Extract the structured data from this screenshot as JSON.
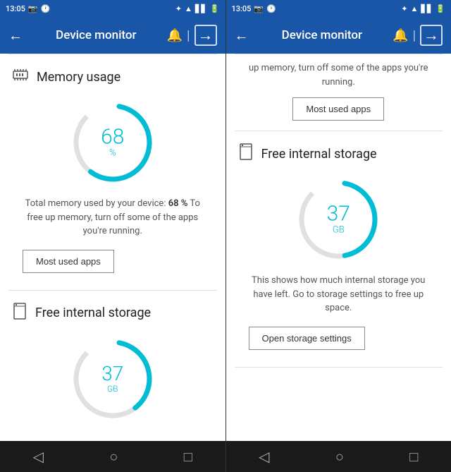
{
  "panel1": {
    "statusBar": {
      "time": "13:05",
      "icons": [
        "📷",
        "🔵"
      ]
    },
    "toolbar": {
      "title": "Device monitor",
      "backIcon": "←",
      "bellIcon": "🔔",
      "divider": "|",
      "exitIcon": "⊡"
    },
    "memorySection": {
      "icon": "⬡",
      "title": "Memory usage",
      "gaugeValue": "68",
      "gaugeUnit": "%",
      "description": "Total memory used by your device: 68 % To free up memory, turn off some of the apps you're running.",
      "buttonLabel": "Most used apps"
    },
    "storageSection": {
      "icon": "🗒",
      "title": "Free internal storage"
    },
    "bottomNav": {
      "back": "◁",
      "home": "○",
      "recent": "□"
    }
  },
  "panel2": {
    "statusBar": {
      "time": "13:05"
    },
    "toolbar": {
      "title": "Device monitor",
      "backIcon": "←",
      "bellIcon": "🔔",
      "divider": "|",
      "exitIcon": "⊡"
    },
    "scrolledText": "up memory, turn off some of the apps you're running.",
    "mostUsedAppsButton": "Most used apps",
    "storageSection": {
      "icon": "🗒",
      "title": "Free internal storage",
      "gaugeValue": "37",
      "gaugeUnit": "GB",
      "description": "This shows how much internal storage you have left. Go to storage settings to free up space.",
      "buttonLabel": "Open storage settings"
    },
    "bottomNav": {
      "back": "◁",
      "home": "○",
      "recent": "□"
    }
  }
}
